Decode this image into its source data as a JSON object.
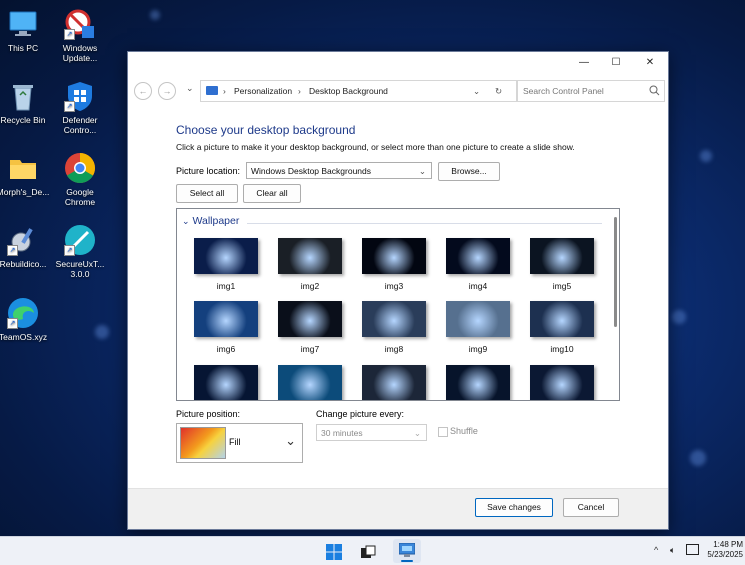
{
  "desktop": {
    "icons": [
      {
        "label": "This PC"
      },
      {
        "label": "Windows Update..."
      },
      {
        "label": "Recycle Bin"
      },
      {
        "label": "Defender Contro..."
      },
      {
        "label": "Morph's_De..."
      },
      {
        "label": "Google Chrome"
      },
      {
        "label": "Rebuildico..."
      },
      {
        "label": "SecureUxT... 3.0.0"
      },
      {
        "label": "TeamOS.xyz"
      }
    ]
  },
  "window": {
    "controls": {
      "minimize": "—",
      "maximize": "☐",
      "close": "✕"
    },
    "address": {
      "back_icon": "←",
      "forward_icon": "→",
      "crumbs": [
        "Personalization",
        "Desktop Background"
      ],
      "separator": "›",
      "refresh_icon": "↻",
      "search_placeholder": "Search Control Panel"
    },
    "heading": "Choose your desktop background",
    "subtitle": "Click a picture to make it your desktop background, or select more than one picture to create a slide show.",
    "picture_location_label": "Picture location:",
    "picture_location_value": "Windows Desktop Backgrounds",
    "browse_label": "Browse...",
    "select_all_label": "Select all",
    "clear_all_label": "Clear all",
    "group_label": "Wallpaper",
    "thumbnails": [
      {
        "label": "img1",
        "color": "#0a1d4a"
      },
      {
        "label": "img2",
        "color": "#1a1f26"
      },
      {
        "label": "img3",
        "color": "#020611"
      },
      {
        "label": "img4",
        "color": "#030a1d"
      },
      {
        "label": "img5",
        "color": "#0b1421"
      },
      {
        "label": "img6",
        "color": "#14407e"
      },
      {
        "label": "img7",
        "color": "#0a0f1a"
      },
      {
        "label": "img8",
        "color": "#2a3d5a"
      },
      {
        "label": "img9",
        "color": "#56708f"
      },
      {
        "label": "img10",
        "color": "#1d3050"
      },
      {
        "label": "",
        "color": "#061533"
      },
      {
        "label": "",
        "color": "#0c4b7a"
      },
      {
        "label": "",
        "color": "#1c2638"
      },
      {
        "label": "",
        "color": "#07142b"
      },
      {
        "label": "",
        "color": "#0b1833"
      }
    ],
    "picture_position_label": "Picture position:",
    "picture_position_value": "Fill",
    "change_every_label": "Change picture every:",
    "change_every_value": "30 minutes",
    "shuffle_label": "Shuffle",
    "save_label": "Save changes",
    "cancel_label": "Cancel"
  },
  "taskbar": {
    "time": "1:48 PM",
    "date": "5/23/2025",
    "tray_chevron": "^"
  },
  "colors": {
    "accent": "#0067c0",
    "heading": "#1e3a8a"
  }
}
